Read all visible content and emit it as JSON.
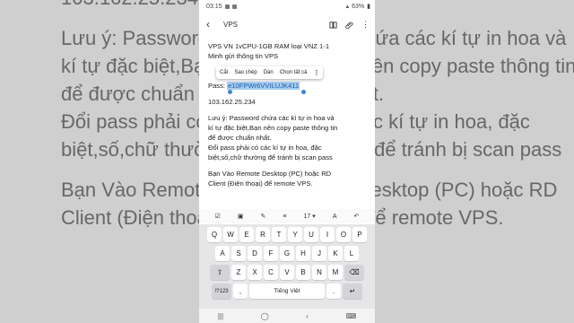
{
  "status": {
    "time": "03:15",
    "battery": "63%"
  },
  "appbar": {
    "back_icon": "‹",
    "title": "VPS"
  },
  "note_lines": {
    "l1": "VPS VN 1vCPU-1GB RAM loại VNZ 1-1",
    "l2": "Minh gửi thông tin VPS",
    "pass_label": "Pass: ",
    "pass_value": "e10FPWr6VVILUJK411",
    "ip": "103.162.25.234",
    "n1": "Lưu ý: Password chứa các kí tự in hoa và",
    "n2": "kí tự đặc biệt,Bạn nên copy paste thông tin",
    "n3": "để được chuẩn nhất.",
    "n4": "Đổi pass phải có các kí tự in hoa, đặc",
    "n5": "biệt,số,chữ thường để tránh bị scan pass",
    "r1": "Bạn Vào Remote Desktop (PC) hoặc RD",
    "r2": "Client (Điện thoại) để remote VPS."
  },
  "context_menu": {
    "cut": "Cắt",
    "copy": "Sao chép",
    "paste": "Dán",
    "select_all": "Chọn tất cả"
  },
  "format_bar": {
    "font_size": "17"
  },
  "keyboard": {
    "row1": [
      "Q",
      "W",
      "E",
      "R",
      "T",
      "Y",
      "U",
      "I",
      "O",
      "P"
    ],
    "row2": [
      "A",
      "S",
      "D",
      "F",
      "G",
      "H",
      "J",
      "K",
      "L"
    ],
    "row3": [
      "Z",
      "X",
      "C",
      "V",
      "B",
      "N",
      "M"
    ],
    "symbols": "!?123",
    "comma": ",",
    "language": "Tiếng Việt",
    "period": "."
  },
  "background_text": {
    "b1": "103.162.25.234",
    "b2": "Lưu ý: Password chứa các kí tự in hoa và",
    "b3": "kí tự đặc biệt,Bạn nên copy paste thông tin",
    "b4": "để được chuẩn nhất.",
    "b5": "Đổi pass phải có các kí tự in hoa, đặc",
    "b6": "biệt,số,chữ thường để tránh bị scan pass",
    "b7": "Bạn Vào Remote Desktop (PC) hoặc RD",
    "b8": "Client (Điện thoại) để remote VPS."
  },
  "colors": {
    "selection": "#a6cbf0",
    "selection_text": "#1f5fa8",
    "handle": "#3b82d6"
  }
}
